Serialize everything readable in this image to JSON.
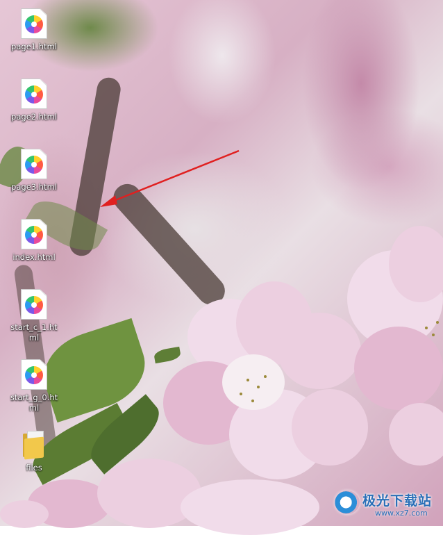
{
  "desktop": {
    "icons": [
      {
        "label": "page1.html",
        "type": "html-file",
        "icon": "browser-html-file-icon"
      },
      {
        "label": "page2.html",
        "type": "html-file",
        "icon": "browser-html-file-icon"
      },
      {
        "label": "page3.html",
        "type": "html-file",
        "icon": "browser-html-file-icon"
      },
      {
        "label": "index.html",
        "type": "html-file",
        "icon": "browser-html-file-icon"
      },
      {
        "label": "start_c_1.ht\nml",
        "type": "html-file",
        "icon": "browser-html-file-icon"
      },
      {
        "label": "start_g_0.ht\nml",
        "type": "html-file",
        "icon": "browser-html-file-icon"
      },
      {
        "label": "files",
        "type": "folder",
        "icon": "folder-icon"
      }
    ]
  },
  "annotation": {
    "arrow_color": "#e02020"
  },
  "watermark": {
    "brand": "极光下载站",
    "url": "www.xz7.com"
  }
}
